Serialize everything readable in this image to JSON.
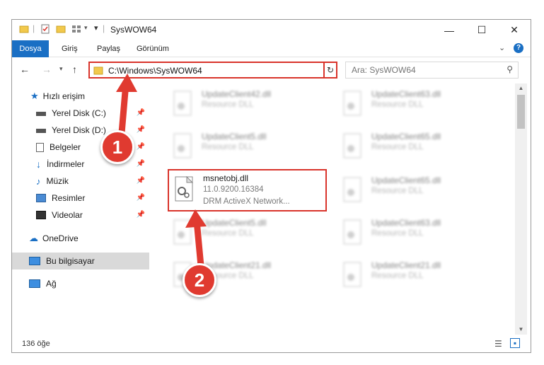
{
  "window": {
    "title": "SysWOW64"
  },
  "ribbon": {
    "tabs": [
      "Dosya",
      "Giriş",
      "Paylaş",
      "Görünüm"
    ]
  },
  "address": {
    "path": "C:\\Windows\\SysWOW64"
  },
  "search": {
    "placeholder": "Ara: SysWOW64"
  },
  "nav": {
    "items": [
      {
        "label": "Hızlı erişim",
        "icon": "star-icon",
        "pinned": false
      },
      {
        "label": "Yerel Disk (C:)",
        "icon": "drive-icon",
        "pinned": true
      },
      {
        "label": "Yerel Disk (D:)",
        "icon": "drive-icon",
        "pinned": true
      },
      {
        "label": "Belgeler",
        "icon": "documents-icon",
        "pinned": true
      },
      {
        "label": "İndirmeler",
        "icon": "downloads-icon",
        "pinned": true
      },
      {
        "label": "Müzik",
        "icon": "music-icon",
        "pinned": true
      },
      {
        "label": "Resimler",
        "icon": "pictures-icon",
        "pinned": true
      },
      {
        "label": "Videolar",
        "icon": "videos-icon",
        "pinned": true
      },
      {
        "label": "OneDrive",
        "icon": "cloud-icon",
        "pinned": false
      },
      {
        "label": "Bu bilgisayar",
        "icon": "computer-icon",
        "pinned": false
      },
      {
        "label": "Ağ",
        "icon": "network-icon",
        "pinned": false
      }
    ]
  },
  "files": {
    "left": [
      {
        "name": "UpdateClient42.dll",
        "type": "Resource DLL"
      },
      {
        "name": "UpdateClient5.dll",
        "type": "Resource DLL"
      },
      {
        "name": "msnetobj.dll",
        "version": "11.0.9200.16384",
        "type": "DRM ActiveX Network..."
      },
      {
        "name": "UpdateClient5.dll",
        "type": "Resource DLL"
      },
      {
        "name": "UpdateClient21.dll",
        "type": "Resource DLL"
      }
    ],
    "right": [
      {
        "name": "UpdateClient63.dll",
        "type": "Resource DLL"
      },
      {
        "name": "UpdateClient65.dll",
        "type": "Resource DLL"
      },
      {
        "name": "UpdateClient65.dll",
        "type": "Resource DLL"
      },
      {
        "name": "UpdateClient63.dll",
        "type": "Resource DLL"
      },
      {
        "name": "UpdateClient21.dll",
        "type": "Resource DLL"
      }
    ]
  },
  "status": {
    "count": "136 öğe"
  },
  "callouts": [
    "1",
    "2"
  ],
  "colors": {
    "accent": "#1a6fc4",
    "highlight": "#d9342b",
    "callout": "#e03a30"
  }
}
